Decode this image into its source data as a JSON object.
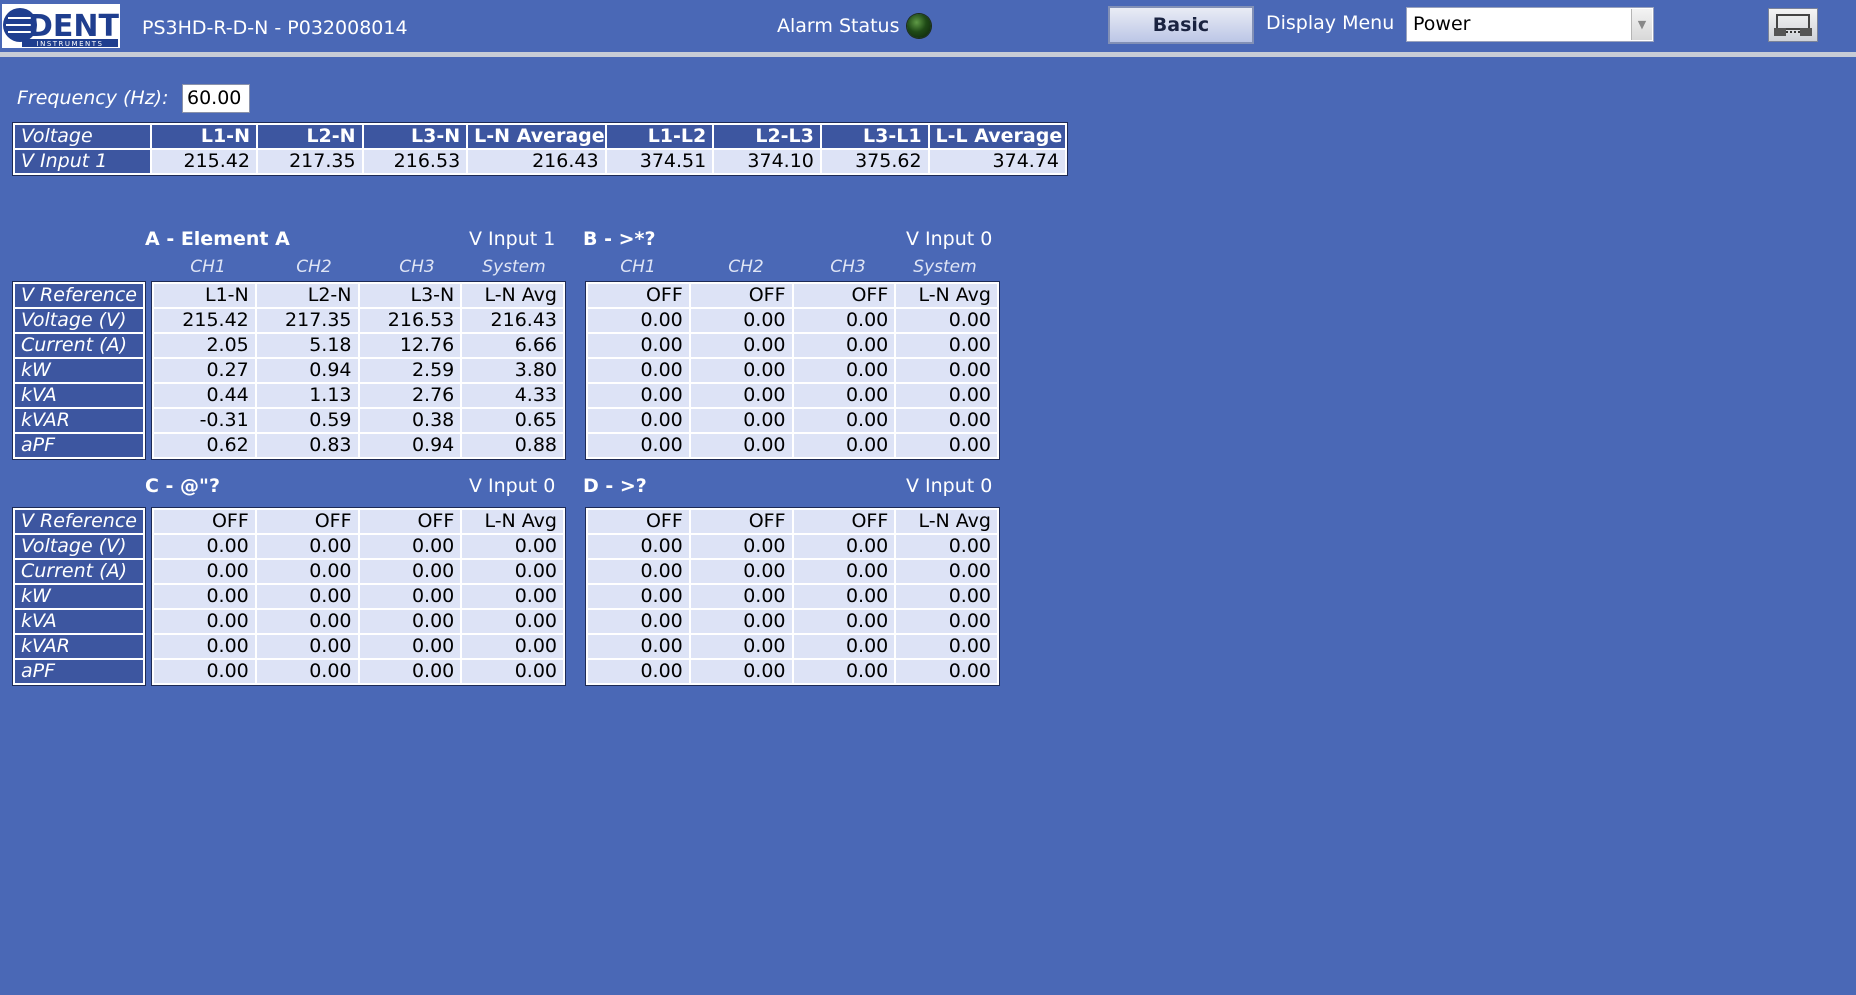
{
  "header": {
    "logo_text": "DENT",
    "logo_sub": "INSTRUMENTS",
    "device": "PS3HD-R-D-N - P032008014",
    "alarm_label": "Alarm Status",
    "basic_label": "Basic",
    "display_menu_label": "Display Menu",
    "display_menu_value": "Power"
  },
  "frequency": {
    "label": "Frequency (Hz):",
    "value": "60.00"
  },
  "voltage_table": {
    "headers": [
      "Voltage",
      "L1-N",
      "L2-N",
      "L3-N",
      "L-N Average",
      "L1-L2",
      "L2-L3",
      "L3-L1",
      "L-L Average"
    ],
    "row": [
      "V Input 1",
      "215.42",
      "217.35",
      "216.53",
      "216.43",
      "374.51",
      "374.10",
      "375.62",
      "374.74"
    ]
  },
  "row_labels": [
    "V Reference",
    "Voltage (V)",
    "Current (A)",
    "kW",
    "kVA",
    "kVAR",
    "aPF"
  ],
  "channel_headers": [
    "CH1",
    "CH2",
    "CH3",
    "System"
  ],
  "elements": {
    "a": {
      "title": "A - Element A",
      "vinput": "V Input 1",
      "rows": [
        [
          "L1-N",
          "L2-N",
          "L3-N",
          "L-N Avg"
        ],
        [
          "215.42",
          "217.35",
          "216.53",
          "216.43"
        ],
        [
          "2.05",
          "5.18",
          "12.76",
          "6.66"
        ],
        [
          "0.27",
          "0.94",
          "2.59",
          "3.80"
        ],
        [
          "0.44",
          "1.13",
          "2.76",
          "4.33"
        ],
        [
          "-0.31",
          "0.59",
          "0.38",
          "0.65"
        ],
        [
          "0.62",
          "0.83",
          "0.94",
          "0.88"
        ]
      ]
    },
    "b": {
      "title": "B - >*?",
      "vinput": "V Input 0",
      "rows": [
        [
          "OFF",
          "OFF",
          "OFF",
          "L-N Avg"
        ],
        [
          "0.00",
          "0.00",
          "0.00",
          "0.00"
        ],
        [
          "0.00",
          "0.00",
          "0.00",
          "0.00"
        ],
        [
          "0.00",
          "0.00",
          "0.00",
          "0.00"
        ],
        [
          "0.00",
          "0.00",
          "0.00",
          "0.00"
        ],
        [
          "0.00",
          "0.00",
          "0.00",
          "0.00"
        ],
        [
          "0.00",
          "0.00",
          "0.00",
          "0.00"
        ]
      ]
    },
    "c": {
      "title": "C - @\"?",
      "vinput": "V Input 0",
      "rows": [
        [
          "OFF",
          "OFF",
          "OFF",
          "L-N Avg"
        ],
        [
          "0.00",
          "0.00",
          "0.00",
          "0.00"
        ],
        [
          "0.00",
          "0.00",
          "0.00",
          "0.00"
        ],
        [
          "0.00",
          "0.00",
          "0.00",
          "0.00"
        ],
        [
          "0.00",
          "0.00",
          "0.00",
          "0.00"
        ],
        [
          "0.00",
          "0.00",
          "0.00",
          "0.00"
        ],
        [
          "0.00",
          "0.00",
          "0.00",
          "0.00"
        ]
      ]
    },
    "d": {
      "title": "D - >?",
      "vinput": "V Input 0",
      "rows": [
        [
          "OFF",
          "OFF",
          "OFF",
          "L-N Avg"
        ],
        [
          "0.00",
          "0.00",
          "0.00",
          "0.00"
        ],
        [
          "0.00",
          "0.00",
          "0.00",
          "0.00"
        ],
        [
          "0.00",
          "0.00",
          "0.00",
          "0.00"
        ],
        [
          "0.00",
          "0.00",
          "0.00",
          "0.00"
        ],
        [
          "0.00",
          "0.00",
          "0.00",
          "0.00"
        ],
        [
          "0.00",
          "0.00",
          "0.00",
          "0.00"
        ]
      ]
    }
  }
}
